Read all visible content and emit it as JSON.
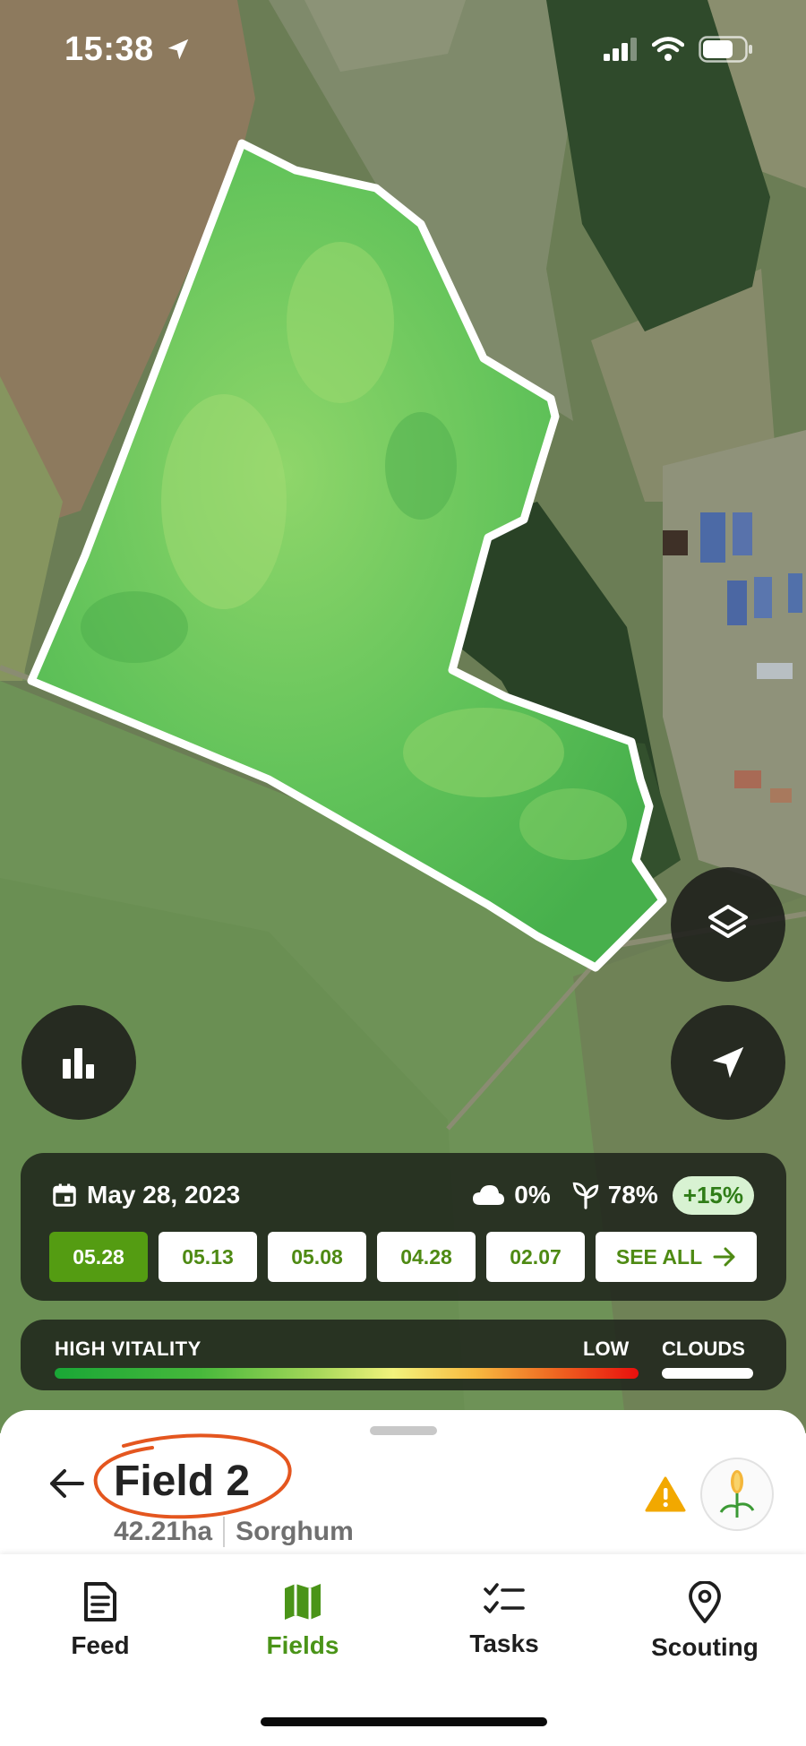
{
  "status_bar": {
    "time": "15:38"
  },
  "map": {
    "stats_button": "bar-chart-icon",
    "layers_button": "layers-icon",
    "locate_button": "navigation-arrow-icon"
  },
  "date_panel": {
    "date": "May 28, 2023",
    "cloud_cover": "0%",
    "vegetation": "78%",
    "vegetation_change": "+15%",
    "dates": [
      "05.28",
      "05.13",
      "05.08",
      "04.28",
      "02.07"
    ],
    "selected_date": "05.28",
    "see_all": "SEE ALL"
  },
  "legend": {
    "high": "HIGH VITALITY",
    "low": "LOW",
    "clouds": "CLOUDS"
  },
  "field": {
    "name": "Field 2",
    "area": "42.21ha",
    "crop": "Sorghum"
  },
  "tabs": [
    {
      "label": "Feed",
      "icon": "document-icon"
    },
    {
      "label": "Fields",
      "icon": "map-icon"
    },
    {
      "label": "Tasks",
      "icon": "checklist-icon"
    },
    {
      "label": "Scouting",
      "icon": "location-pin-icon"
    }
  ],
  "colors": {
    "accent": "#549c12",
    "active_tab": "#4a9418",
    "field_green": "#5cc156",
    "warning": "#f2a800",
    "annotation": "#e4561f"
  }
}
